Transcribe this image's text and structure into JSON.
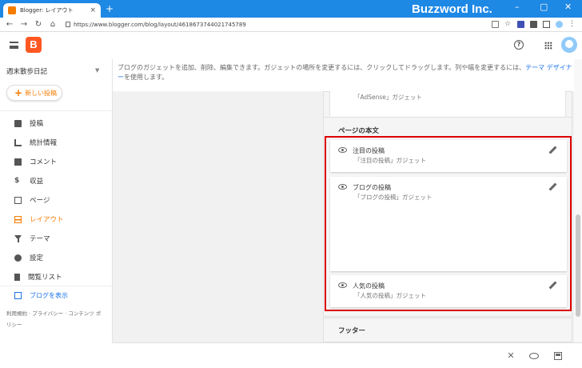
{
  "browser": {
    "tab_title": "Blogger: レイアウト",
    "tab_close": "×",
    "new_tab": "+",
    "url": "https://www.blogger.com/blog/layout/4618673744021745789",
    "brand": "Buzzword Inc."
  },
  "sidebar": {
    "blog_title": "週末散歩日記",
    "new_post_label": "新しい投稿",
    "items": [
      {
        "label": "投稿",
        "icon": "posts-icon"
      },
      {
        "label": "統計情報",
        "icon": "stats-icon"
      },
      {
        "label": "コメント",
        "icon": "comment-icon"
      },
      {
        "label": "収益",
        "icon": "dollar-icon"
      },
      {
        "label": "ページ",
        "icon": "pages-icon"
      },
      {
        "label": "レイアウト",
        "icon": "layout-icon",
        "active": true
      },
      {
        "label": "テーマ",
        "icon": "theme-icon"
      },
      {
        "label": "設定",
        "icon": "gear-icon"
      },
      {
        "label": "閲覧リスト",
        "icon": "bookmark-icon"
      }
    ],
    "view_blog": "ブログを表示",
    "footer_links": "利用規約 · プライバシー · コンテンツ ポリシー"
  },
  "main": {
    "description_pre": "ブログのガジェットを追加、削除、編集できます。ガジェットの場所を変更するには、クリックしてドラッグします。列や幅を変更するには、",
    "description_link": "テーマ デザイナー",
    "description_post": "を使用します。",
    "top_gadget_sub": "「AdSense」ガジェット",
    "body_section_title": "ページの本文",
    "gadgets": [
      {
        "title": "注目の投稿",
        "sub": "「注目の投稿」ガジェット"
      },
      {
        "title": "ブログの投稿",
        "sub": "「ブログの投稿」ガジェット"
      },
      {
        "title": "人気の投稿",
        "sub": "「人気の投稿」ガジェット"
      }
    ],
    "footer_section_title": "フッター"
  },
  "colors": {
    "accent": "#f57c00",
    "link": "#1a73e8",
    "highlight_border": "#dd0000",
    "browser_blue": "#1e88e5"
  }
}
